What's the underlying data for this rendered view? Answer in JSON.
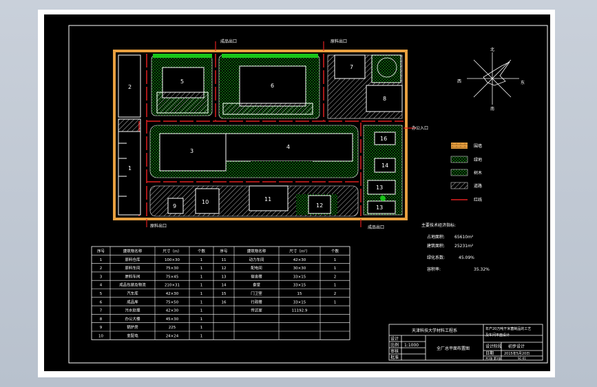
{
  "buildings": [
    {
      "id": "1"
    },
    {
      "id": "2"
    },
    {
      "id": "3"
    },
    {
      "id": "4"
    },
    {
      "id": "5"
    },
    {
      "id": "6"
    },
    {
      "id": "7"
    },
    {
      "id": "8"
    },
    {
      "id": "9"
    },
    {
      "id": "10"
    },
    {
      "id": "11"
    },
    {
      "id": "12"
    },
    {
      "id": "13"
    },
    {
      "id": "13"
    },
    {
      "id": "14"
    },
    {
      "id": "16"
    }
  ],
  "gate_labels": {
    "top_left": "成品出口",
    "top_right": "原料出口",
    "right": "办公入口",
    "bottom_left": "原料出口",
    "bottom_right": "成品出口"
  },
  "compass": {
    "n": "北",
    "s": "南",
    "e": "东",
    "w": "西"
  },
  "legend": [
    {
      "label": "围墙",
      "kind": "wall"
    },
    {
      "label": "绿地",
      "kind": "green"
    },
    {
      "label": "树木",
      "kind": "tree"
    },
    {
      "label": "道路",
      "kind": "road"
    },
    {
      "label": "红线",
      "kind": "line"
    }
  ],
  "indicators": {
    "title": "主要技术经济指标:",
    "rows": [
      {
        "label": "占地面积:",
        "value": "65610m²"
      },
      {
        "label": "建筑面积:",
        "value": "25231m²"
      },
      {
        "label": "绿化系数:",
        "value": "45.09%"
      },
      {
        "label": "容积率:",
        "value": "35.32%"
      }
    ]
  },
  "table": {
    "headers": [
      "序号",
      "建筑物名称",
      "尺寸（m）",
      "个数",
      "序号",
      "建筑物名称",
      "尺寸（m²）",
      "个数"
    ],
    "rows": [
      [
        "1",
        "原料仓库",
        "100×30",
        "1",
        "11",
        "动力车间",
        "42×30",
        "1"
      ],
      [
        "2",
        "原料车间",
        "75×30",
        "1",
        "12",
        "配电间",
        "30×30",
        "1"
      ],
      [
        "3",
        "原料车间",
        "75×45",
        "1",
        "13",
        "宿舍楼",
        "33×15",
        "2"
      ],
      [
        "4",
        "成品包装及物流",
        "210×31",
        "1",
        "14",
        "食堂",
        "33×15",
        "1"
      ],
      [
        "5",
        "汽车库",
        "42×30",
        "1",
        "15",
        "门卫室",
        "15",
        "2"
      ],
      [
        "6",
        "成品库",
        "75×50",
        "1",
        "16",
        "行政楼",
        "33×15",
        "1"
      ],
      [
        "7",
        "污水处理",
        "42×30",
        "1",
        "",
        "传达室",
        "11192.9",
        ""
      ],
      [
        "8",
        "办公大楼",
        "45×30",
        "1",
        "",
        "",
        "",
        ""
      ],
      [
        "9",
        "锅炉房",
        "225",
        "1",
        "",
        "",
        "",
        ""
      ],
      [
        "10",
        "变配电",
        "24×24",
        "1",
        "",
        "",
        "",
        ""
      ]
    ]
  },
  "title_block": {
    "school": "天津科技大学材料工程系",
    "project_line1": "年产20万吨干米菌制品的工艺",
    "project_line2": "及车间平面设计",
    "drawing_name": "全厂总平面布置图",
    "scale_label": "比例",
    "scale": "1:1000",
    "design_label": "设计",
    "check_label": "审核",
    "approve_label": "批准",
    "date_label": "日期",
    "date": "2015年5月20日",
    "finish_label": "设计阶段",
    "finish": "初步设计",
    "sheet": "共1张 第1张",
    "drawing_no": "SC-01"
  }
}
